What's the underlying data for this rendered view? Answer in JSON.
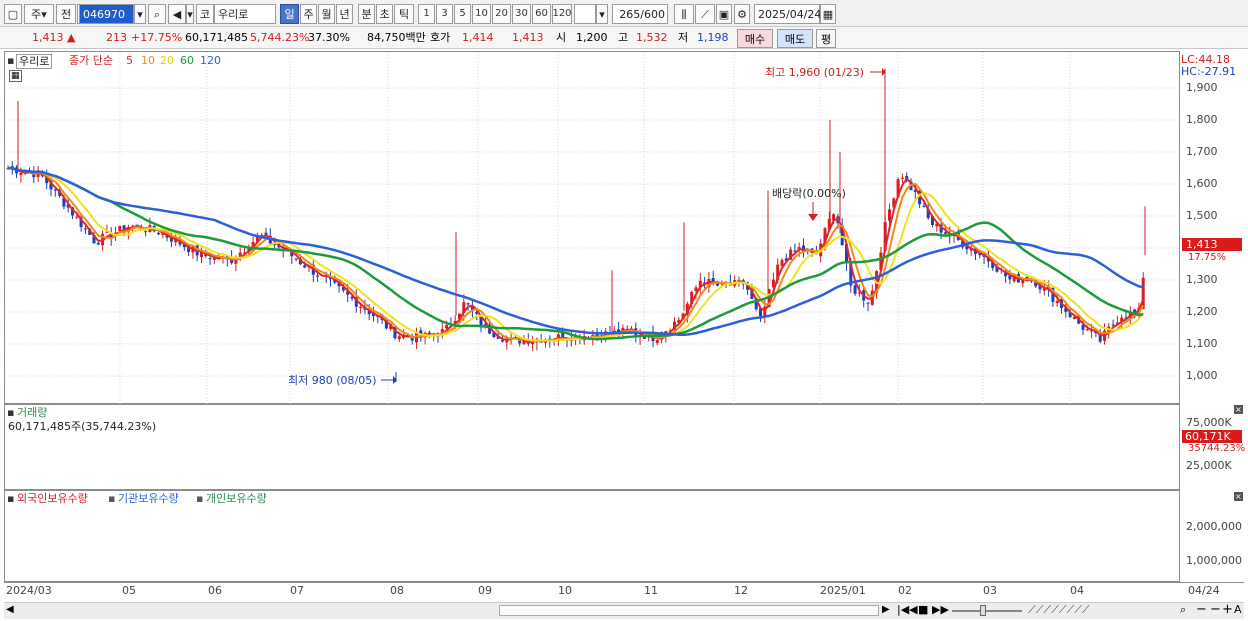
{
  "toolbar": {
    "period_type": "주",
    "prev_label": "전",
    "code": "046970",
    "market_label": "코",
    "stock_name": "우리로",
    "period_tabs": [
      "일",
      "주",
      "월",
      "년",
      "분",
      "초",
      "틱"
    ],
    "selected_period": "일",
    "intervals": [
      "1",
      "3",
      "5",
      "10",
      "20",
      "30",
      "60",
      "120"
    ],
    "count": "265",
    "count_max": "/600",
    "date": "2025/04/24"
  },
  "quote": {
    "price": "1,413",
    "change_arrow": "▲",
    "change": "213",
    "change_pct": "+17.75%",
    "volume": "60,171,485",
    "volume_pct": "5,744.23%",
    "turnover_pct": "37.30%",
    "amount": "84,750백만",
    "ask_label": "호가",
    "ask": "1,414",
    "bid": "1,413",
    "open_label": "시",
    "open": "1,200",
    "high_label": "고",
    "high": "1,532",
    "low_label": "저",
    "low": "1,198",
    "buy_label": "매수",
    "sell_label": "매도",
    "flat_label": "평"
  },
  "price_pane": {
    "name": "우리로",
    "legend_prefix": "종가 단순",
    "ma_periods": [
      "5",
      "10",
      "20",
      "60",
      "120"
    ],
    "ma_colors": [
      "#e0262b",
      "#f08a1c",
      "#f2e21d",
      "#1e9a3c",
      "#2f5fd6"
    ],
    "lc": "LC:44.18",
    "hc": "HC:-27.91",
    "y_ticks": [
      "1,900",
      "1,800",
      "1,700",
      "1,600",
      "1,500",
      "1,400",
      "1,300",
      "1,200",
      "1,100",
      "1,000"
    ],
    "current_price_tag": "1,413",
    "current_pct_tag": "17.75%",
    "high_annot": "최고 1,960 (01/23)",
    "low_annot": "최저 980 (08/05)",
    "dividend_annot": "배당락(0.00%)"
  },
  "volume_pane": {
    "title": "거래량",
    "value_line": "60,171,485주(35,744.23%)",
    "y_ticks": [
      "75,000K",
      "25,000K"
    ],
    "current_tag": "60,171K",
    "current_pct_tag": "35744.23%"
  },
  "holding_pane": {
    "series": [
      "외국인보유수량",
      "기관보유수량",
      "개인보유수량"
    ],
    "series_colors": [
      "#d41f1f",
      "#2f62e0",
      "#2e8b57"
    ],
    "y_ticks": [
      "2,000,000",
      "1,000,000"
    ]
  },
  "x_axis": {
    "labels": [
      "2024/03",
      "05",
      "06",
      "07",
      "08",
      "09",
      "10",
      "11",
      "12",
      "2025/01",
      "02",
      "03",
      "04",
      "04/24"
    ]
  }
}
